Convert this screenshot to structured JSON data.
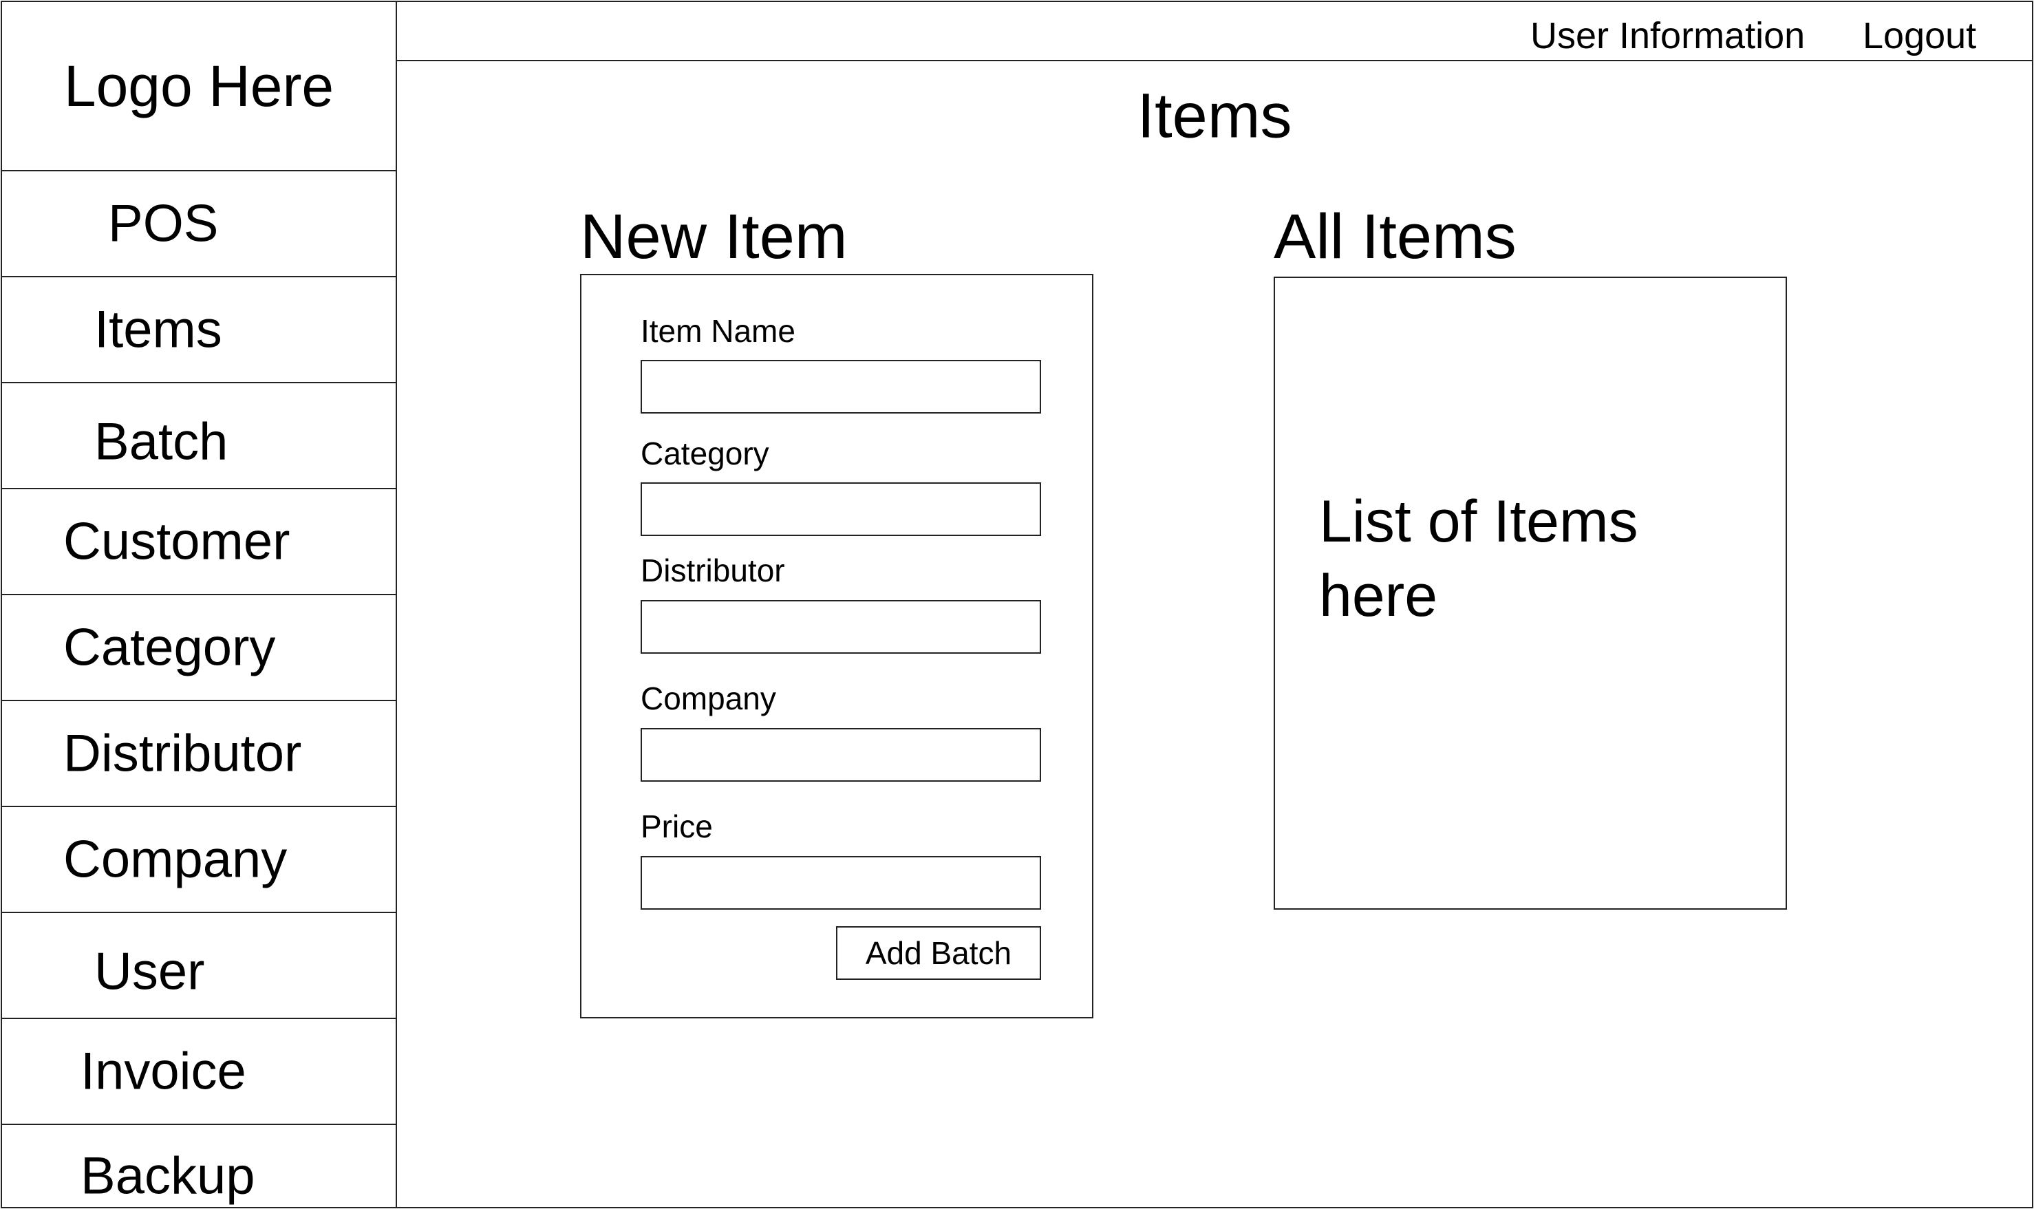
{
  "sidebar": {
    "logo": "Logo Here",
    "items": [
      {
        "label": "POS"
      },
      {
        "label": "Items"
      },
      {
        "label": "Batch"
      },
      {
        "label": "Customer"
      },
      {
        "label": "Category"
      },
      {
        "label": "Distributor"
      },
      {
        "label": "Company"
      },
      {
        "label": "User"
      },
      {
        "label": "Invoice"
      },
      {
        "label": "Backup"
      }
    ]
  },
  "header": {
    "user_info": "User Information",
    "logout": "Logout",
    "title": "Items"
  },
  "new_item": {
    "title": "New Item",
    "fields": [
      {
        "label": "Item Name",
        "value": "",
        "placeholder": ""
      },
      {
        "label": "Category",
        "value": "",
        "placeholder": ""
      },
      {
        "label": "Distributor",
        "value": "",
        "placeholder": ""
      },
      {
        "label": "Company",
        "value": "",
        "placeholder": ""
      },
      {
        "label": "Price",
        "value": "",
        "placeholder": ""
      }
    ],
    "submit_label": "Add Batch"
  },
  "all_items": {
    "title": "All Items",
    "placeholder_text": "List of Items here"
  }
}
